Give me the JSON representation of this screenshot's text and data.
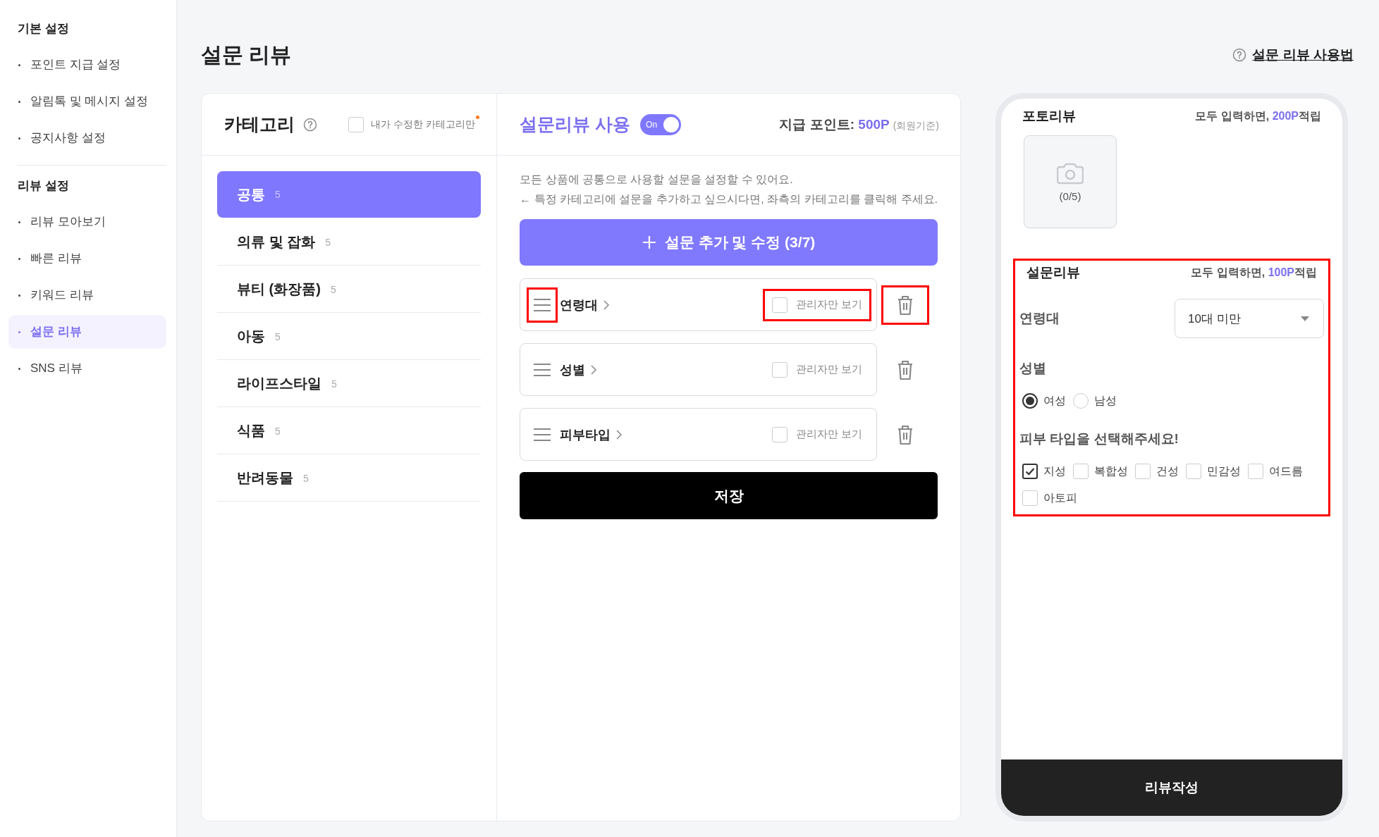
{
  "sidebar": {
    "sections": [
      {
        "title": "기본 설정",
        "items": [
          {
            "label": "포인트 지급 설정",
            "selected": false
          },
          {
            "label": "알림톡 및 메시지 설정",
            "selected": false
          },
          {
            "label": "공지사항 설정",
            "selected": false
          }
        ]
      },
      {
        "title": "리뷰 설정",
        "items": [
          {
            "label": "리뷰 모아보기",
            "selected": false
          },
          {
            "label": "빠른 리뷰",
            "selected": false
          },
          {
            "label": "키워드 리뷰",
            "selected": false
          },
          {
            "label": "설문 리뷰",
            "selected": true
          },
          {
            "label": "SNS 리뷰",
            "selected": false
          }
        ]
      }
    ]
  },
  "page": {
    "title": "설문 리뷰",
    "help_link": "설문 리뷰 사용법"
  },
  "categories": {
    "title": "카테고리",
    "filter": {
      "label": "내가 수정한 카테고리만",
      "checked": false
    },
    "items": [
      {
        "name": "공통",
        "count": "5",
        "selected": true
      },
      {
        "name": "의류 및 잡화",
        "count": "5",
        "selected": false
      },
      {
        "name": "뷰티 (화장품)",
        "count": "5",
        "selected": false
      },
      {
        "name": "아동",
        "count": "5",
        "selected": false
      },
      {
        "name": "라이프스타일",
        "count": "5",
        "selected": false
      },
      {
        "name": "식품",
        "count": "5",
        "selected": false
      },
      {
        "name": "반려동물",
        "count": "5",
        "selected": false
      }
    ]
  },
  "survey": {
    "title": "설문리뷰 사용",
    "toggle": {
      "label": "On",
      "on": true
    },
    "points_label": "지급 포인트:",
    "points_value": "500P",
    "points_note": "(회원기준)",
    "description": [
      "모든 상품에 공통으로 사용할 설문을 설정할 수 있어요.",
      "← 특정 카테고리에 설문을 추가하고 싶으시다면, 좌측의 카테고리를 클릭해 주세요."
    ],
    "add_button": "설문 추가 및 수정 (3/7)",
    "questions": [
      {
        "name": "연령대",
        "admin_only": {
          "label": "관리자만 보기",
          "checked": false
        },
        "handle_highlighted": true,
        "admin_highlighted": true,
        "delete_highlighted": true
      },
      {
        "name": "성별",
        "admin_only": {
          "label": "관리자만 보기",
          "checked": false
        },
        "handle_highlighted": false,
        "admin_highlighted": false,
        "delete_highlighted": false
      },
      {
        "name": "피부타입",
        "admin_only": {
          "label": "관리자만 보기",
          "checked": false
        },
        "handle_highlighted": false,
        "admin_highlighted": false,
        "delete_highlighted": false
      }
    ],
    "save_button": "저장"
  },
  "preview": {
    "photo": {
      "title": "포토리뷰",
      "reward_prefix": "모두 입력하면,",
      "reward_points": "200P",
      "reward_suffix": "적립",
      "counter": "(0/5)"
    },
    "survey": {
      "title": "설문리뷰",
      "reward_prefix": "모두 입력하면,",
      "reward_points": "100P",
      "reward_suffix": "적립",
      "highlighted": true,
      "questions": [
        {
          "kind": "select",
          "label": "연령대",
          "value": "10대 미만"
        },
        {
          "kind": "radio",
          "label": "성별",
          "options": [
            {
              "label": "여성",
              "selected": true
            },
            {
              "label": "남성",
              "selected": false
            }
          ]
        },
        {
          "kind": "checkbox",
          "label": "피부 타입을 선택해주세요!",
          "options": [
            {
              "label": "지성",
              "checked": true
            },
            {
              "label": "복합성",
              "checked": false
            },
            {
              "label": "건성",
              "checked": false
            },
            {
              "label": "민감성",
              "checked": false
            },
            {
              "label": "여드름",
              "checked": false
            },
            {
              "label": "아토피",
              "checked": false
            }
          ]
        }
      ]
    },
    "submit_button": "리뷰작성"
  }
}
